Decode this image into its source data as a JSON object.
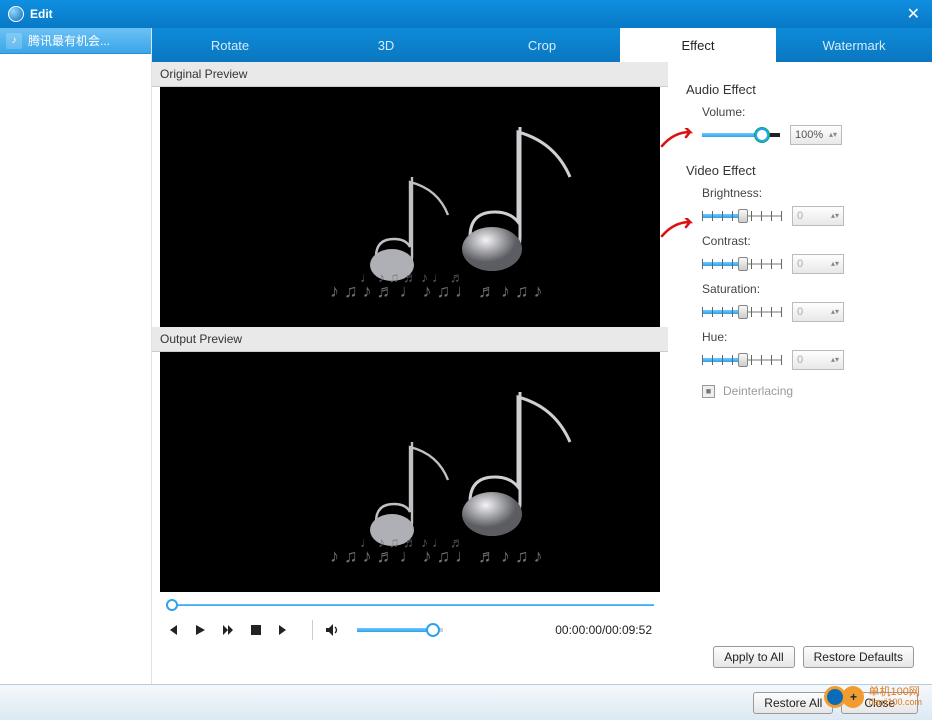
{
  "window": {
    "title": "Edit"
  },
  "sidebar": {
    "items": [
      {
        "label": "腾讯最有机会..."
      }
    ]
  },
  "tabs": [
    {
      "id": "rotate",
      "label": "Rotate",
      "active": false
    },
    {
      "id": "3d",
      "label": "3D",
      "active": false
    },
    {
      "id": "crop",
      "label": "Crop",
      "active": false
    },
    {
      "id": "effect",
      "label": "Effect",
      "active": true
    },
    {
      "id": "watermark",
      "label": "Watermark",
      "active": false
    }
  ],
  "preview": {
    "original_label": "Original Preview",
    "output_label": "Output Preview"
  },
  "effects": {
    "audio_section": "Audio Effect",
    "volume_label": "Volume:",
    "volume_value": "100%",
    "video_section": "Video Effect",
    "brightness_label": "Brightness:",
    "brightness_value": "0",
    "contrast_label": "Contrast:",
    "contrast_value": "0",
    "saturation_label": "Saturation:",
    "saturation_value": "0",
    "hue_label": "Hue:",
    "hue_value": "0",
    "deinterlacing_label": "Deinterlacing"
  },
  "player": {
    "current_time": "00:00:00",
    "total_time": "00:09:52",
    "time_display": "00:00:00/00:09:52"
  },
  "buttons": {
    "apply_all": "Apply to All",
    "restore_defaults": "Restore Defaults",
    "restore_all": "Restore All",
    "close": "Close"
  },
  "watermark": {
    "line1": "单机100网",
    "line2": "danji100.com"
  }
}
